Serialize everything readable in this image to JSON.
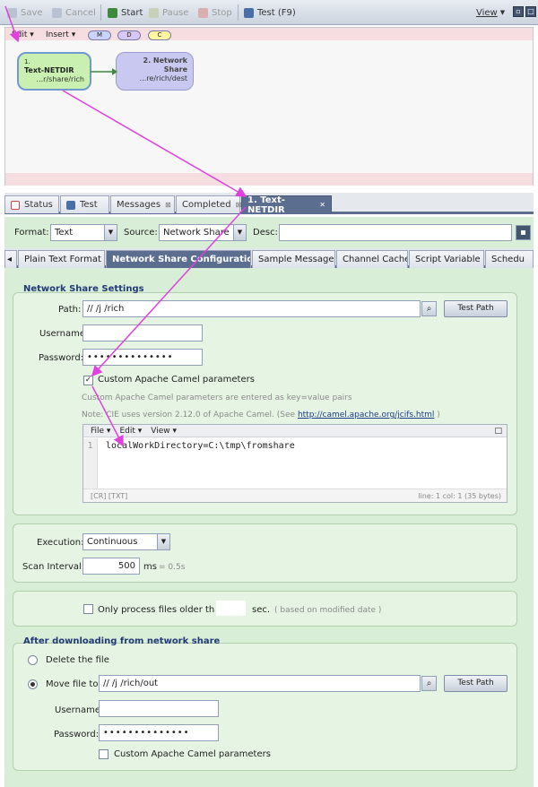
{
  "toolbar": {
    "save": "Save",
    "cancel": "Cancel",
    "start": "Start",
    "pause": "Pause",
    "stop": "Stop",
    "test": "Test (F9)",
    "view": "View"
  },
  "canvas": {
    "edit": "Edit",
    "insert": "Insert",
    "pills": [
      "M",
      "D",
      "C"
    ],
    "node1": {
      "num": "1.",
      "name": "Text-NETDIR",
      "path": "...r/share/rich"
    },
    "node2": {
      "num": "2. Network",
      "name": "Share",
      "path": "...re/rich/dest"
    }
  },
  "tabs": {
    "status": "Status",
    "test": "Test",
    "messages": "Messages",
    "completed": "Completed",
    "active": "1. Text-NETDIR"
  },
  "format_row": {
    "format_label": "Format:",
    "format_value": "Text",
    "source_label": "Source:",
    "source_value": "Network Share",
    "desc_label": "Desc:",
    "desc_value": ""
  },
  "subtabs": [
    "Plain Text Format",
    "Network Share Configuration",
    "Sample Messages",
    "Channel Cache",
    "Script Variable",
    "Schedu"
  ],
  "settings": {
    "title": "Network Share Settings",
    "path_label": "Path:",
    "path_value": "//          /j            /rich",
    "test_path": "Test Path",
    "username_label": "Username:",
    "username_value": "",
    "password_label": "Password:",
    "password_value": "••••••••••••••",
    "camel_checkbox": "Custom Apache Camel parameters",
    "camel_hint1": "Custom Apache Camel parameters are entered as key=value pairs",
    "camel_hint2": "Note: CIE uses version 2.12.0 of Apache Camel. (See",
    "camel_link": "http://camel.apache.org/jcifs.html",
    "camel_hint3": ")"
  },
  "editor": {
    "menus": [
      "File",
      "Edit",
      "View"
    ],
    "line_number": "1",
    "code": "localWorkDirectory=C:\\tmp\\fromshare",
    "status_left": "[CR] [TXT]",
    "status_right": "line: 1  col: 1  (35 bytes)"
  },
  "execution": {
    "execution_label": "Execution:",
    "execution_value": "Continuous",
    "scan_label": "Scan Interval:",
    "scan_value": "500",
    "scan_unit": "ms",
    "scan_hint": "= 0.5s"
  },
  "older": {
    "label": "Only process files older than",
    "value": "",
    "unit": "sec.",
    "hint": "( based on modified date )"
  },
  "after": {
    "title": "After downloading from network share",
    "delete": "Delete the file",
    "move": "Move file to:",
    "move_value": "//             /j                /rich/out",
    "test_path": "Test Path",
    "username_label": "Username:",
    "username_value": "",
    "password_label": "Password:",
    "password_value": "••••••••••••••",
    "camel_checkbox": "Custom Apache Camel parameters"
  },
  "colors": {
    "accent": "#5b6e90",
    "panel": "#d9eed6",
    "arrow": "#e040e0",
    "node1": "#c9f0b0",
    "node2": "#c8c8f0"
  }
}
